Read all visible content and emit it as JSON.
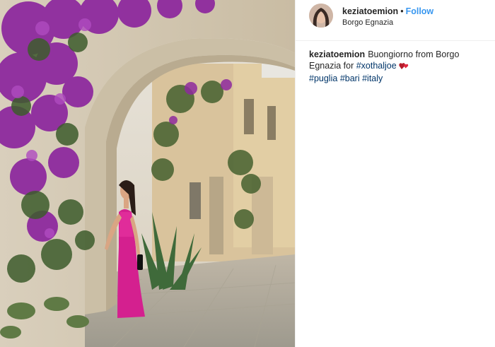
{
  "post": {
    "username": "keziatoemion",
    "separator": "•",
    "follow_label": "Follow",
    "location": "Borgo Egnazia",
    "caption": {
      "username": "keziatoemion",
      "text_part1": "Buongiorno from Borgo Egnazia for",
      "mention_tag": "#xothaljoe",
      "hashtags": [
        "#puglia",
        "#bari",
        "#italy"
      ]
    },
    "photo_icon": "photo-image",
    "heart_icon": "two-hearts-emoji",
    "colors": {
      "follow": "#3897f0",
      "hashtag": "#003569",
      "text": "#262626",
      "dress": "#d4208f",
      "bougainvillea": "#8e2a9e"
    }
  }
}
